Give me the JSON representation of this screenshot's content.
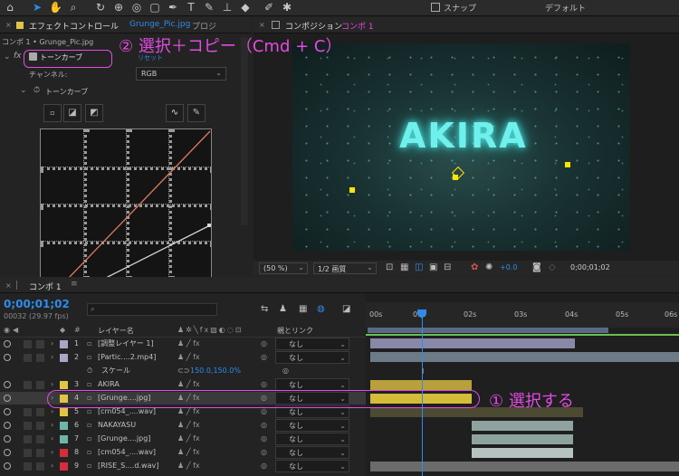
{
  "toolbar": {
    "snap_label": "スナップ",
    "workspace": "デフォルト",
    "icons": [
      "home-icon",
      "selection-arrow-icon",
      "hand-icon",
      "zoom-icon",
      "rotate-icon",
      "camera-orbit-icon",
      "pan-behind-icon",
      "rectangle-icon",
      "pen-icon",
      "type-icon",
      "brush-icon",
      "clone-stamp-icon",
      "eraser-icon",
      "roto-brush-icon",
      "puppet-pin-icon"
    ]
  },
  "effect_panel": {
    "tab_label": "エフェクトコントロール",
    "tab_file": "Grunge_Pic.jpg",
    "tab_other": "プロジ",
    "breadcrumb": "コンポ 1 • Grunge_Pic.jpg",
    "effect_name": "トーンカーブ",
    "reset_label": "リセット",
    "channel_label": "チャンネル:",
    "channel_value": "RGB",
    "curves_label": "トーンカーブ"
  },
  "comp_panel": {
    "tab_label": "コンポジション",
    "tab_comp": "コンポ 1",
    "zoom": "(50 %)",
    "resolution": "1/2 画質",
    "exposure": "+0.0",
    "timecode": "0;00;01;02",
    "title_text": "AKIRA"
  },
  "timeline": {
    "tab_label": "コンポ 1",
    "timecode": "0;00;01;02",
    "frame_info": "00032 (29.97 fps)",
    "search_placeholder": "",
    "col_layer_name": "レイヤー名",
    "col_parent": "親とリンク",
    "ruler": [
      "00s",
      "01s",
      "02s",
      "03s",
      "04s",
      "05s",
      "06s"
    ],
    "layers": [
      {
        "num": "1",
        "name": "[調整レイヤー 1]",
        "parent": "なし",
        "color": "#a9a5c9"
      },
      {
        "num": "2",
        "name": "[Partic....2.mp4]",
        "parent": "なし",
        "color": "#a9a5c9"
      },
      {
        "num": "",
        "name": "スケール",
        "parent": "150.0,150.0%",
        "color": ""
      },
      {
        "num": "3",
        "name": "AKIRA",
        "parent": "なし",
        "color": "#e0c445"
      },
      {
        "num": "4",
        "name": "[Grunge....jpg]",
        "parent": "なし",
        "color": "#e0c445"
      },
      {
        "num": "5",
        "name": "[cm054_....wav]",
        "parent": "なし",
        "color": "#e0c445"
      },
      {
        "num": "6",
        "name": "NAKAYASU",
        "parent": "なし",
        "color": "#6fb5a7"
      },
      {
        "num": "7",
        "name": "[Grunge....jpg]",
        "parent": "なし",
        "color": "#6fb5a7"
      },
      {
        "num": "8",
        "name": "[cm054_....wav]",
        "parent": "なし",
        "color": "#d42d3c"
      },
      {
        "num": "9",
        "name": "[RISE_S....d.wav]",
        "parent": "なし",
        "color": "#d42d3c"
      }
    ]
  },
  "annotations": {
    "step2": "② 選択＋コピー（Cmd + C）",
    "step1": "① 選択する"
  },
  "colors": {
    "accent": "#2d8ceb",
    "annotation": "#e34be3",
    "curve_red": "#e07a5a"
  }
}
